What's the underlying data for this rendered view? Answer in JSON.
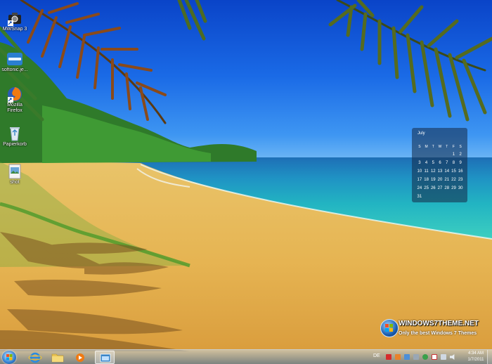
{
  "desktop_icons": [
    {
      "id": "mwsnap",
      "label": "MWSnap 3",
      "icon": "camera-icon"
    },
    {
      "id": "softonic",
      "label": "softonic.je...",
      "icon": "softonic-icon"
    },
    {
      "id": "firefox",
      "label": "Mozilla Firefox",
      "icon": "firefox-icon"
    },
    {
      "id": "recycle",
      "label": "Papierkorb",
      "icon": "recycle-bin-icon"
    },
    {
      "id": "shot",
      "label": "shot",
      "icon": "image-file-icon"
    }
  ],
  "calendar": {
    "month": "July",
    "weekdays": [
      "S",
      "M",
      "T",
      "W",
      "T",
      "F",
      "S"
    ],
    "weeks": [
      [
        "",
        "",
        "",
        "",
        "",
        "1",
        "2"
      ],
      [
        "3",
        "4",
        "5",
        "6",
        "7",
        "8",
        "9"
      ],
      [
        "10",
        "11",
        "12",
        "13",
        "14",
        "15",
        "16"
      ],
      [
        "17",
        "18",
        "19",
        "20",
        "21",
        "22",
        "23"
      ],
      [
        "24",
        "25",
        "26",
        "27",
        "28",
        "29",
        "30"
      ],
      [
        "31",
        "",
        "",
        "",
        "",
        "",
        ""
      ]
    ]
  },
  "watermark": {
    "title": "WINDOWS7THEME.NET",
    "subtitle": "Only the best Windows 7 Themes"
  },
  "taskbar": {
    "pinned": [
      {
        "id": "ie",
        "icon": "internet-explorer-icon"
      },
      {
        "id": "explorer",
        "icon": "folder-icon"
      },
      {
        "id": "media",
        "icon": "media-player-icon"
      },
      {
        "id": "active-app",
        "icon": "app-window-icon"
      }
    ],
    "tray": {
      "language": "DE",
      "time": "4:34 AM",
      "date": "1/7/2011"
    }
  },
  "colors": {
    "sky_top": "#0a44c8",
    "sea": "#22b4c2",
    "sand": "#e8b94e"
  }
}
